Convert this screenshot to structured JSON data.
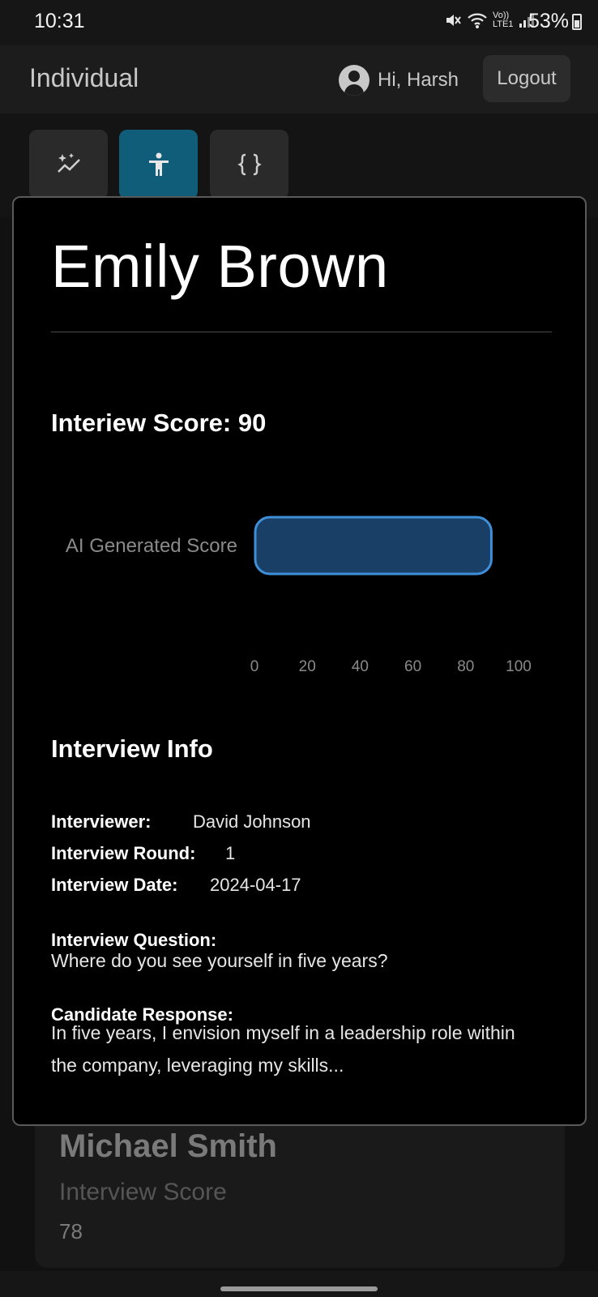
{
  "status_bar": {
    "time": "10:31",
    "network": "Vo)) LTE1",
    "battery": "53%"
  },
  "header": {
    "title": "Individual",
    "greeting": "Hi, Harsh",
    "logout_label": "Logout"
  },
  "toolbar": {
    "buttons": [
      {
        "icon": "sparkle-chart-icon",
        "active": false
      },
      {
        "icon": "person-accessibility-icon",
        "active": true
      },
      {
        "icon": "curly-braces-icon",
        "active": false
      }
    ],
    "accent_color": "#0f5d78"
  },
  "modal": {
    "candidate_name": "Emily Brown",
    "score_title": "Interiew Score: 90",
    "info_title": "Interview Info",
    "interviewer_label": "Interviewer:",
    "interviewer_value": "David Johnson",
    "round_label": "Interview Round:",
    "round_value": "1",
    "date_label": "Interview Date:",
    "date_value": "2024-04-17",
    "question_label": "Interview Question:",
    "question_text": "Where do you see yourself in five years?",
    "response_label": "Candidate Response:",
    "response_text": "In five years, I envision myself in a leadership role within the company, leveraging my skills..."
  },
  "chart_data": {
    "type": "bar",
    "orientation": "horizontal",
    "categories": [
      "AI Generated Score"
    ],
    "values": [
      90
    ],
    "xlim": [
      0,
      100
    ],
    "x_ticks": [
      "0",
      "20",
      "40",
      "60",
      "80",
      "100"
    ],
    "grid": false,
    "bar_fill": "#1a3f66",
    "bar_border": "#3f8fd8"
  },
  "background_card": {
    "name": "Michael Smith",
    "score_label": "Interview Score",
    "score_value": "78"
  }
}
